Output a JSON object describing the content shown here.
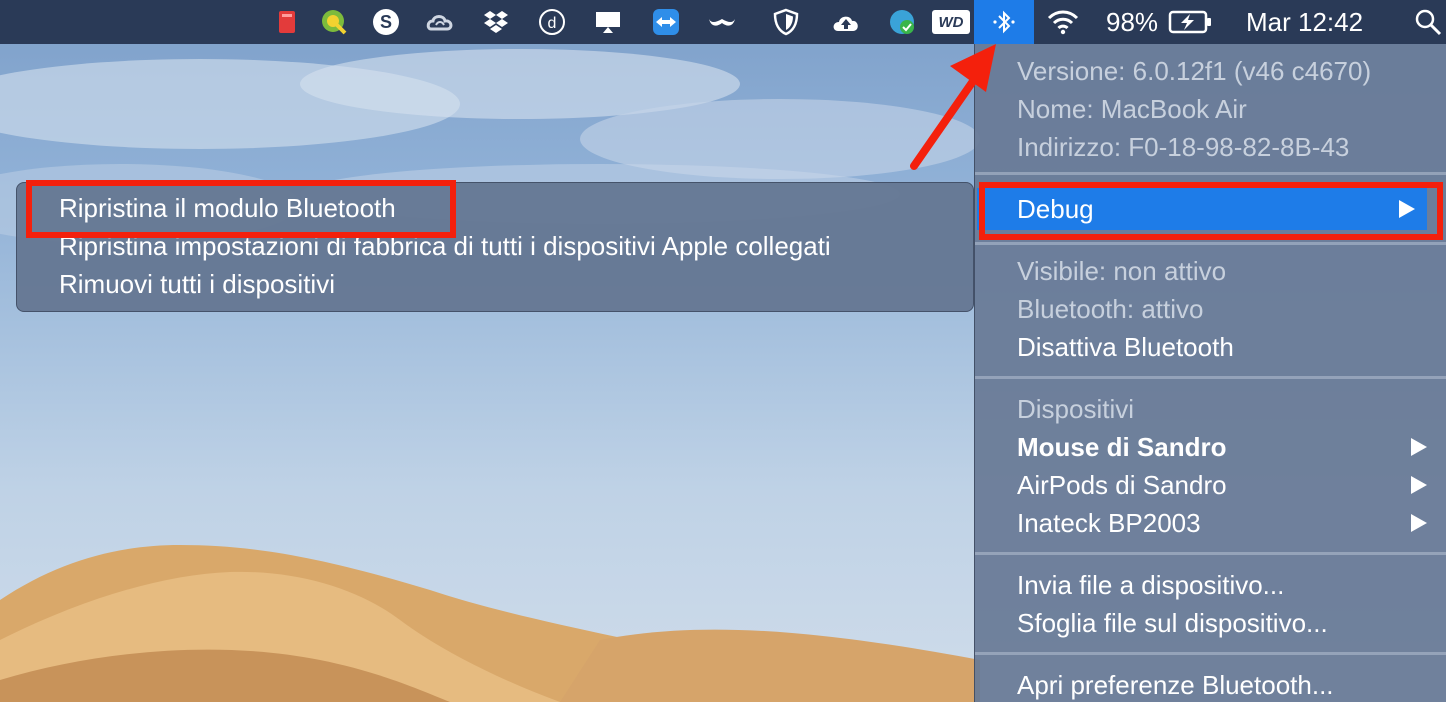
{
  "menubar": {
    "battery_percent": "98%",
    "clock": "Mar 12:42",
    "icons": [
      "flag-icon",
      "qgis-icon",
      "skype-icon",
      "creative-cloud-icon",
      "dropbox-icon",
      "dashlane-icon",
      "airdisplay-icon",
      "teamviewer-icon",
      "moustache-icon",
      "shield-icon",
      "upload-cloud-icon",
      "sync-check-icon",
      "wd-icon",
      "bluetooth-icon",
      "wifi-icon",
      "battery-icon",
      "spotlight-icon"
    ],
    "wd_label": "WD"
  },
  "bluetooth_menu": {
    "version": "Versione: 6.0.12f1 (v46 c4670)",
    "name": "Nome: MacBook Air",
    "address": "Indirizzo: F0-18-98-82-8B-43",
    "debug": "Debug",
    "visible": "Visibile: non attivo",
    "bluetooth_status": "Bluetooth: attivo",
    "toggle": "Disattiva Bluetooth",
    "devices_header": "Dispositivi",
    "devices": [
      "Mouse di Sandro",
      "AirPods di Sandro",
      "Inateck BP2003"
    ],
    "send_file": "Invia file a dispositivo...",
    "browse_file": "Sfoglia file sul dispositivo...",
    "preferences": "Apri preferenze Bluetooth..."
  },
  "debug_submenu": {
    "items": [
      "Ripristina il modulo Bluetooth",
      "Ripristina impostazioni di fabbrica di tutti i dispositivi Apple collegati",
      "Rimuovi tutti i dispositivi"
    ]
  },
  "colors": {
    "menubar": "#2a3a57",
    "highlight": "#1e7ce8",
    "annotation_red": "#f4200c",
    "menu_bg": "#687a96"
  }
}
